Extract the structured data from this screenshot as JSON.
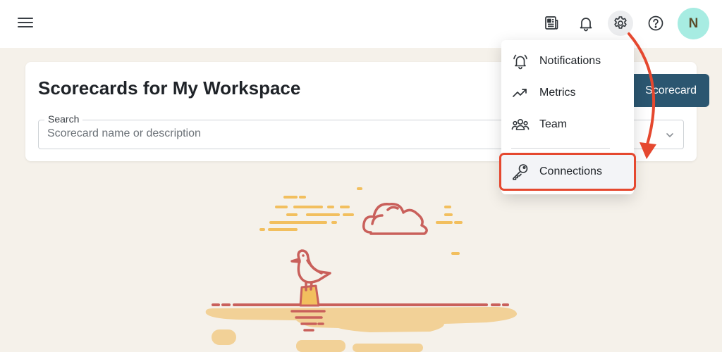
{
  "topbar": {
    "menu_icon": "hamburger-menu-icon",
    "icons": [
      "news-icon",
      "bell-icon",
      "gear-icon",
      "help-icon"
    ],
    "avatar_initial": "N",
    "avatar_color": "#a7ece2"
  },
  "card": {
    "title": "Scorecards for My Workspace",
    "primary_button_label": "Scorecard",
    "primary_button_color": "#2b5670"
  },
  "search": {
    "label": "Search",
    "placeholder": "Scorecard name or description",
    "value": ""
  },
  "settings_menu": {
    "items": [
      {
        "label": "Notifications",
        "icon": "bell-ring-icon"
      },
      {
        "label": "Metrics",
        "icon": "trending-up-icon"
      },
      {
        "label": "Team",
        "icon": "team-icon"
      },
      {
        "label": "Connections",
        "icon": "key-icon"
      }
    ],
    "highlight_color": "#e5482f"
  },
  "illustration": {
    "name": "seagull-on-post-empty-state"
  }
}
